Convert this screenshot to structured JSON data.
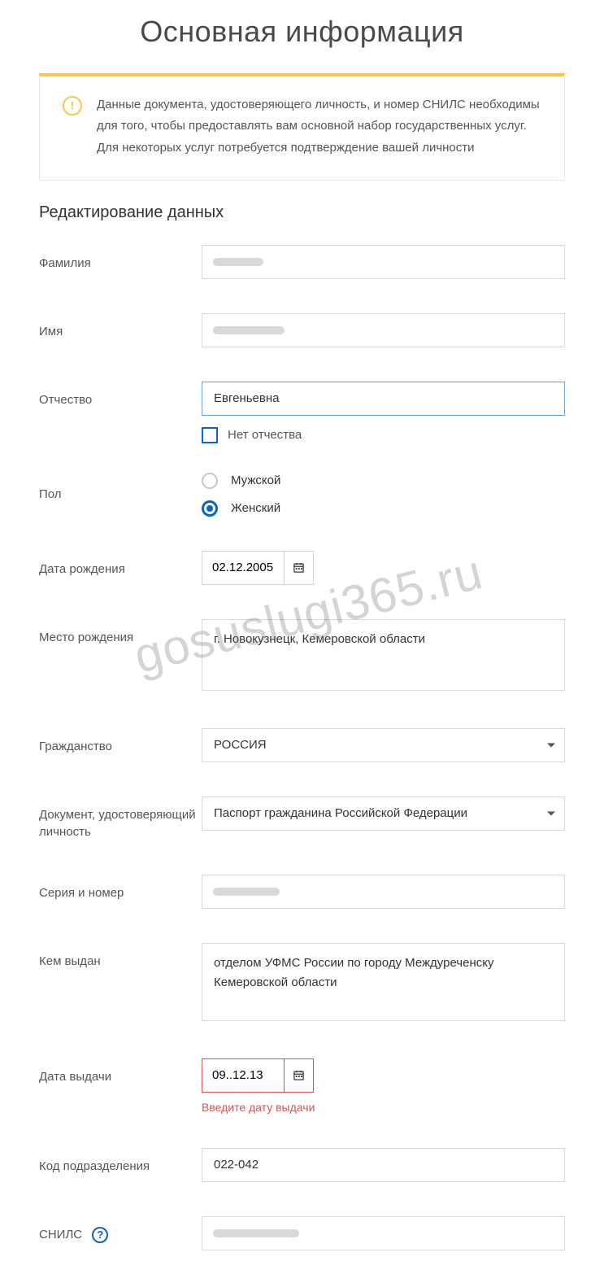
{
  "page": {
    "title": "Основная информация",
    "notice": "Данные документа, удостоверяющего личность, и номер СНИЛС необходимы для того, чтобы предоставлять вам основной набор государственных услуг. Для некоторых услуг потребуется подтверждение вашей личности",
    "section_title": "Редактирование данных"
  },
  "labels": {
    "surname": "Фамилия",
    "name": "Имя",
    "patronymic": "Отчество",
    "no_patronymic": "Нет отчества",
    "gender": "Пол",
    "gender_male": "Мужской",
    "gender_female": "Женский",
    "dob": "Дата рождения",
    "birthplace": "Место рождения",
    "citizenship": "Гражданство",
    "doc_type": "Документ, удостоверяющий личность",
    "series_number": "Серия и номер",
    "issued_by": "Кем выдан",
    "issue_date": "Дата выдачи",
    "division_code": "Код подразделения",
    "snils": "СНИЛС"
  },
  "values": {
    "surname": "",
    "name": "",
    "patronymic": "Евгеньевна",
    "no_patronymic_checked": false,
    "gender_selected": "female",
    "dob": "02.12.2005",
    "birthplace": "г. Новокузнецк, Кемеровской области",
    "citizenship": "РОССИЯ",
    "doc_type": "Паспорт гражданина Российской Федерации",
    "series_number": "",
    "issued_by": "отделом УФМС России по городу Междуреченску Кемеровской области",
    "issue_date": "09..12.13",
    "division_code": "022-042",
    "snils": ""
  },
  "errors": {
    "issue_date": "Введите дату выдачи"
  },
  "help": "?",
  "watermark": "gosuslugi365.ru"
}
